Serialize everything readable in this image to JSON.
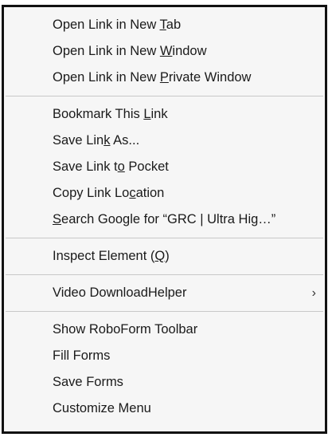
{
  "menu": {
    "groups": [
      {
        "items": [
          {
            "pre": "Open Link in New ",
            "key": "T",
            "post": "ab"
          },
          {
            "pre": "Open Link in New ",
            "key": "W",
            "post": "indow"
          },
          {
            "pre": "Open Link in New ",
            "key": "P",
            "post": "rivate Window"
          }
        ]
      },
      {
        "items": [
          {
            "pre": "Bookmark This ",
            "key": "L",
            "post": "ink"
          },
          {
            "pre": "Save Lin",
            "key": "k",
            "post": " As..."
          },
          {
            "pre": "Save Link t",
            "key": "o",
            "post": " Pocket"
          },
          {
            "pre": "Copy Link Lo",
            "key": "c",
            "post": "ation"
          },
          {
            "pre": "",
            "key": "S",
            "post": "earch Google for “GRC | Ultra Hig…”"
          }
        ]
      },
      {
        "items": [
          {
            "pre": "Inspect Element (",
            "key": "Q",
            "post": ")"
          }
        ]
      },
      {
        "items": [
          {
            "pre": "Video DownloadHelper",
            "key": "",
            "post": "",
            "submenu": true,
            "submenu_glyph": "›"
          }
        ]
      },
      {
        "items": [
          {
            "pre": "Show RoboForm Toolbar",
            "key": "",
            "post": ""
          },
          {
            "pre": "Fill Forms",
            "key": "",
            "post": ""
          },
          {
            "pre": "Save Forms",
            "key": "",
            "post": ""
          },
          {
            "pre": "Customize Menu",
            "key": "",
            "post": ""
          }
        ]
      }
    ]
  }
}
